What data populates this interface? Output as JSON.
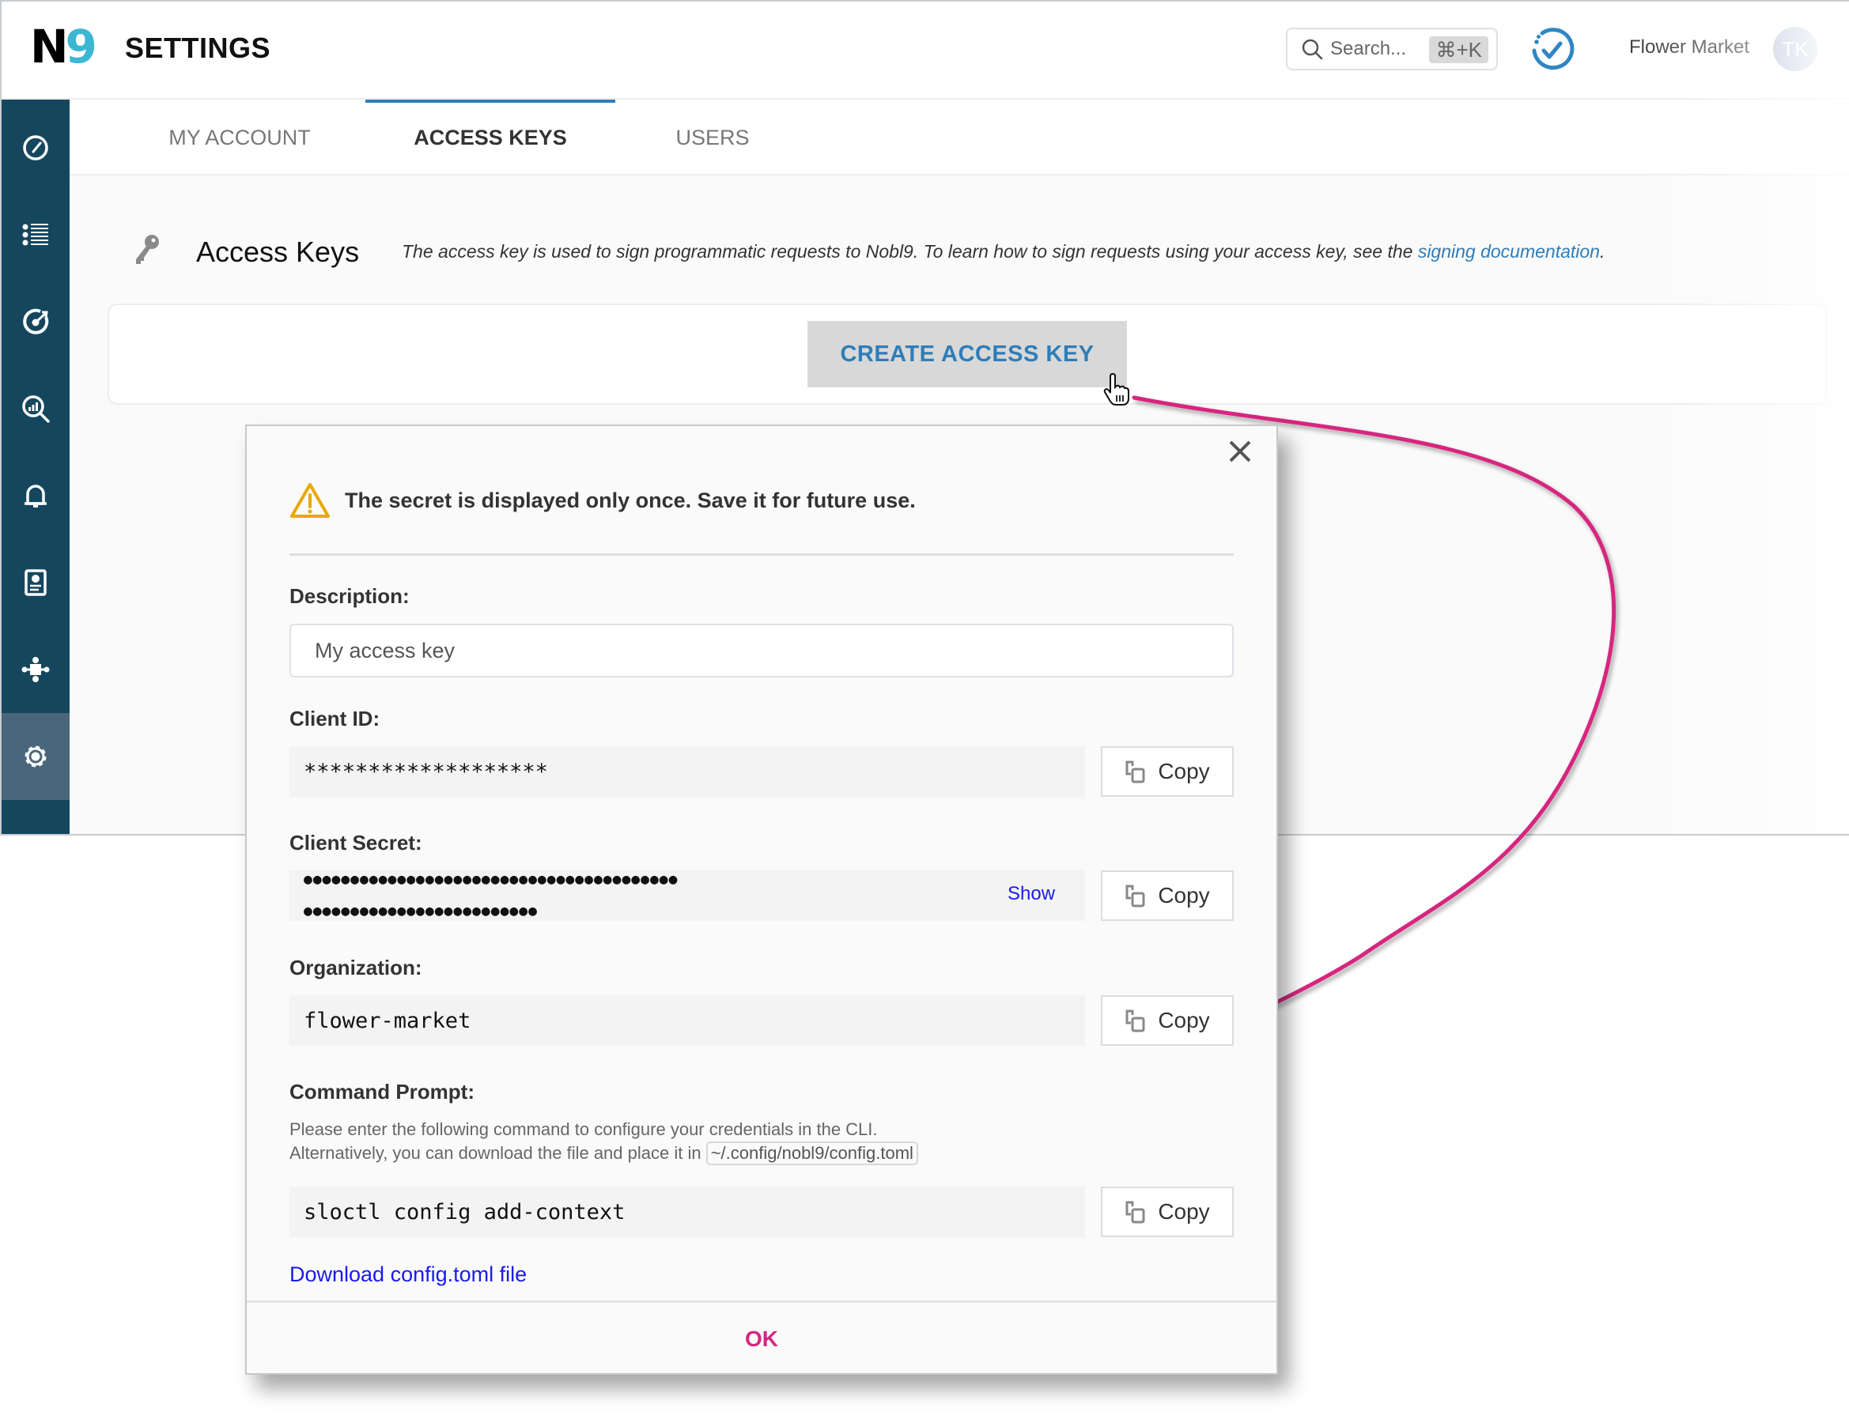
{
  "header": {
    "logo_n": "N",
    "logo_nine": "9",
    "title": "SETTINGS",
    "search": {
      "placeholder": "Search...",
      "shortcut": "⌘+K"
    },
    "org_name": "Flower Market",
    "avatar_initials": "TK"
  },
  "sidebar": {
    "items": [
      {
        "name": "dashboard",
        "icon": "speedometer-icon",
        "active": false
      },
      {
        "name": "services",
        "icon": "list-icon",
        "active": false
      },
      {
        "name": "slos",
        "icon": "target-icon",
        "active": false
      },
      {
        "name": "data-sources",
        "icon": "search-chart-icon",
        "active": false
      },
      {
        "name": "alerts",
        "icon": "bell-icon",
        "active": false
      },
      {
        "name": "reports",
        "icon": "report-icon",
        "active": false
      },
      {
        "name": "integrations",
        "icon": "puzzle-icon",
        "active": false
      },
      {
        "name": "settings",
        "icon": "gear-icon",
        "active": true
      }
    ]
  },
  "tabs": [
    {
      "label": "MY ACCOUNT",
      "active": false
    },
    {
      "label": "ACCESS KEYS",
      "active": true
    },
    {
      "label": "USERS",
      "active": false
    }
  ],
  "section": {
    "title": "Access Keys",
    "description": "The access key is used to sign programmatic requests to Nobl9. To learn how to sign requests using your access key, see the ",
    "link_text": "signing documentation",
    "description_end": ".",
    "create_button": "CREATE ACCESS KEY"
  },
  "modal": {
    "warning": "The secret is displayed only once. Save it for future use.",
    "description_label": "Description:",
    "description_value": "My access key",
    "client_id_label": "Client ID:",
    "client_id_value": "*******************",
    "client_secret_label": "Client Secret:",
    "client_secret_line1": "●●●●●●●●●●●●●●●●●●●●●●●●●●●●●●●●●●●●●●●●",
    "client_secret_line2": "●●●●●●●●●●●●●●●●●●●●●●●●●",
    "show_label": "Show",
    "organization_label": "Organization:",
    "organization_value": "flower-market",
    "command_label": "Command Prompt:",
    "help_line1": "Please enter the following command to configure your credentials in the CLI.",
    "help_line2": "Alternatively, you can download the file and place it in ",
    "config_path": "~/.config/nobl9/config.toml",
    "command_value": "sloctl config add-context",
    "copy_label": "Copy",
    "download_link": "Download config.toml file",
    "ok_label": "OK"
  },
  "colors": {
    "sidebar": "#14475e",
    "accent_blue": "#2f7db8",
    "ok_pink": "#d6257f",
    "annotation_arrow": "#d6257f",
    "warning": "#e8a800"
  }
}
